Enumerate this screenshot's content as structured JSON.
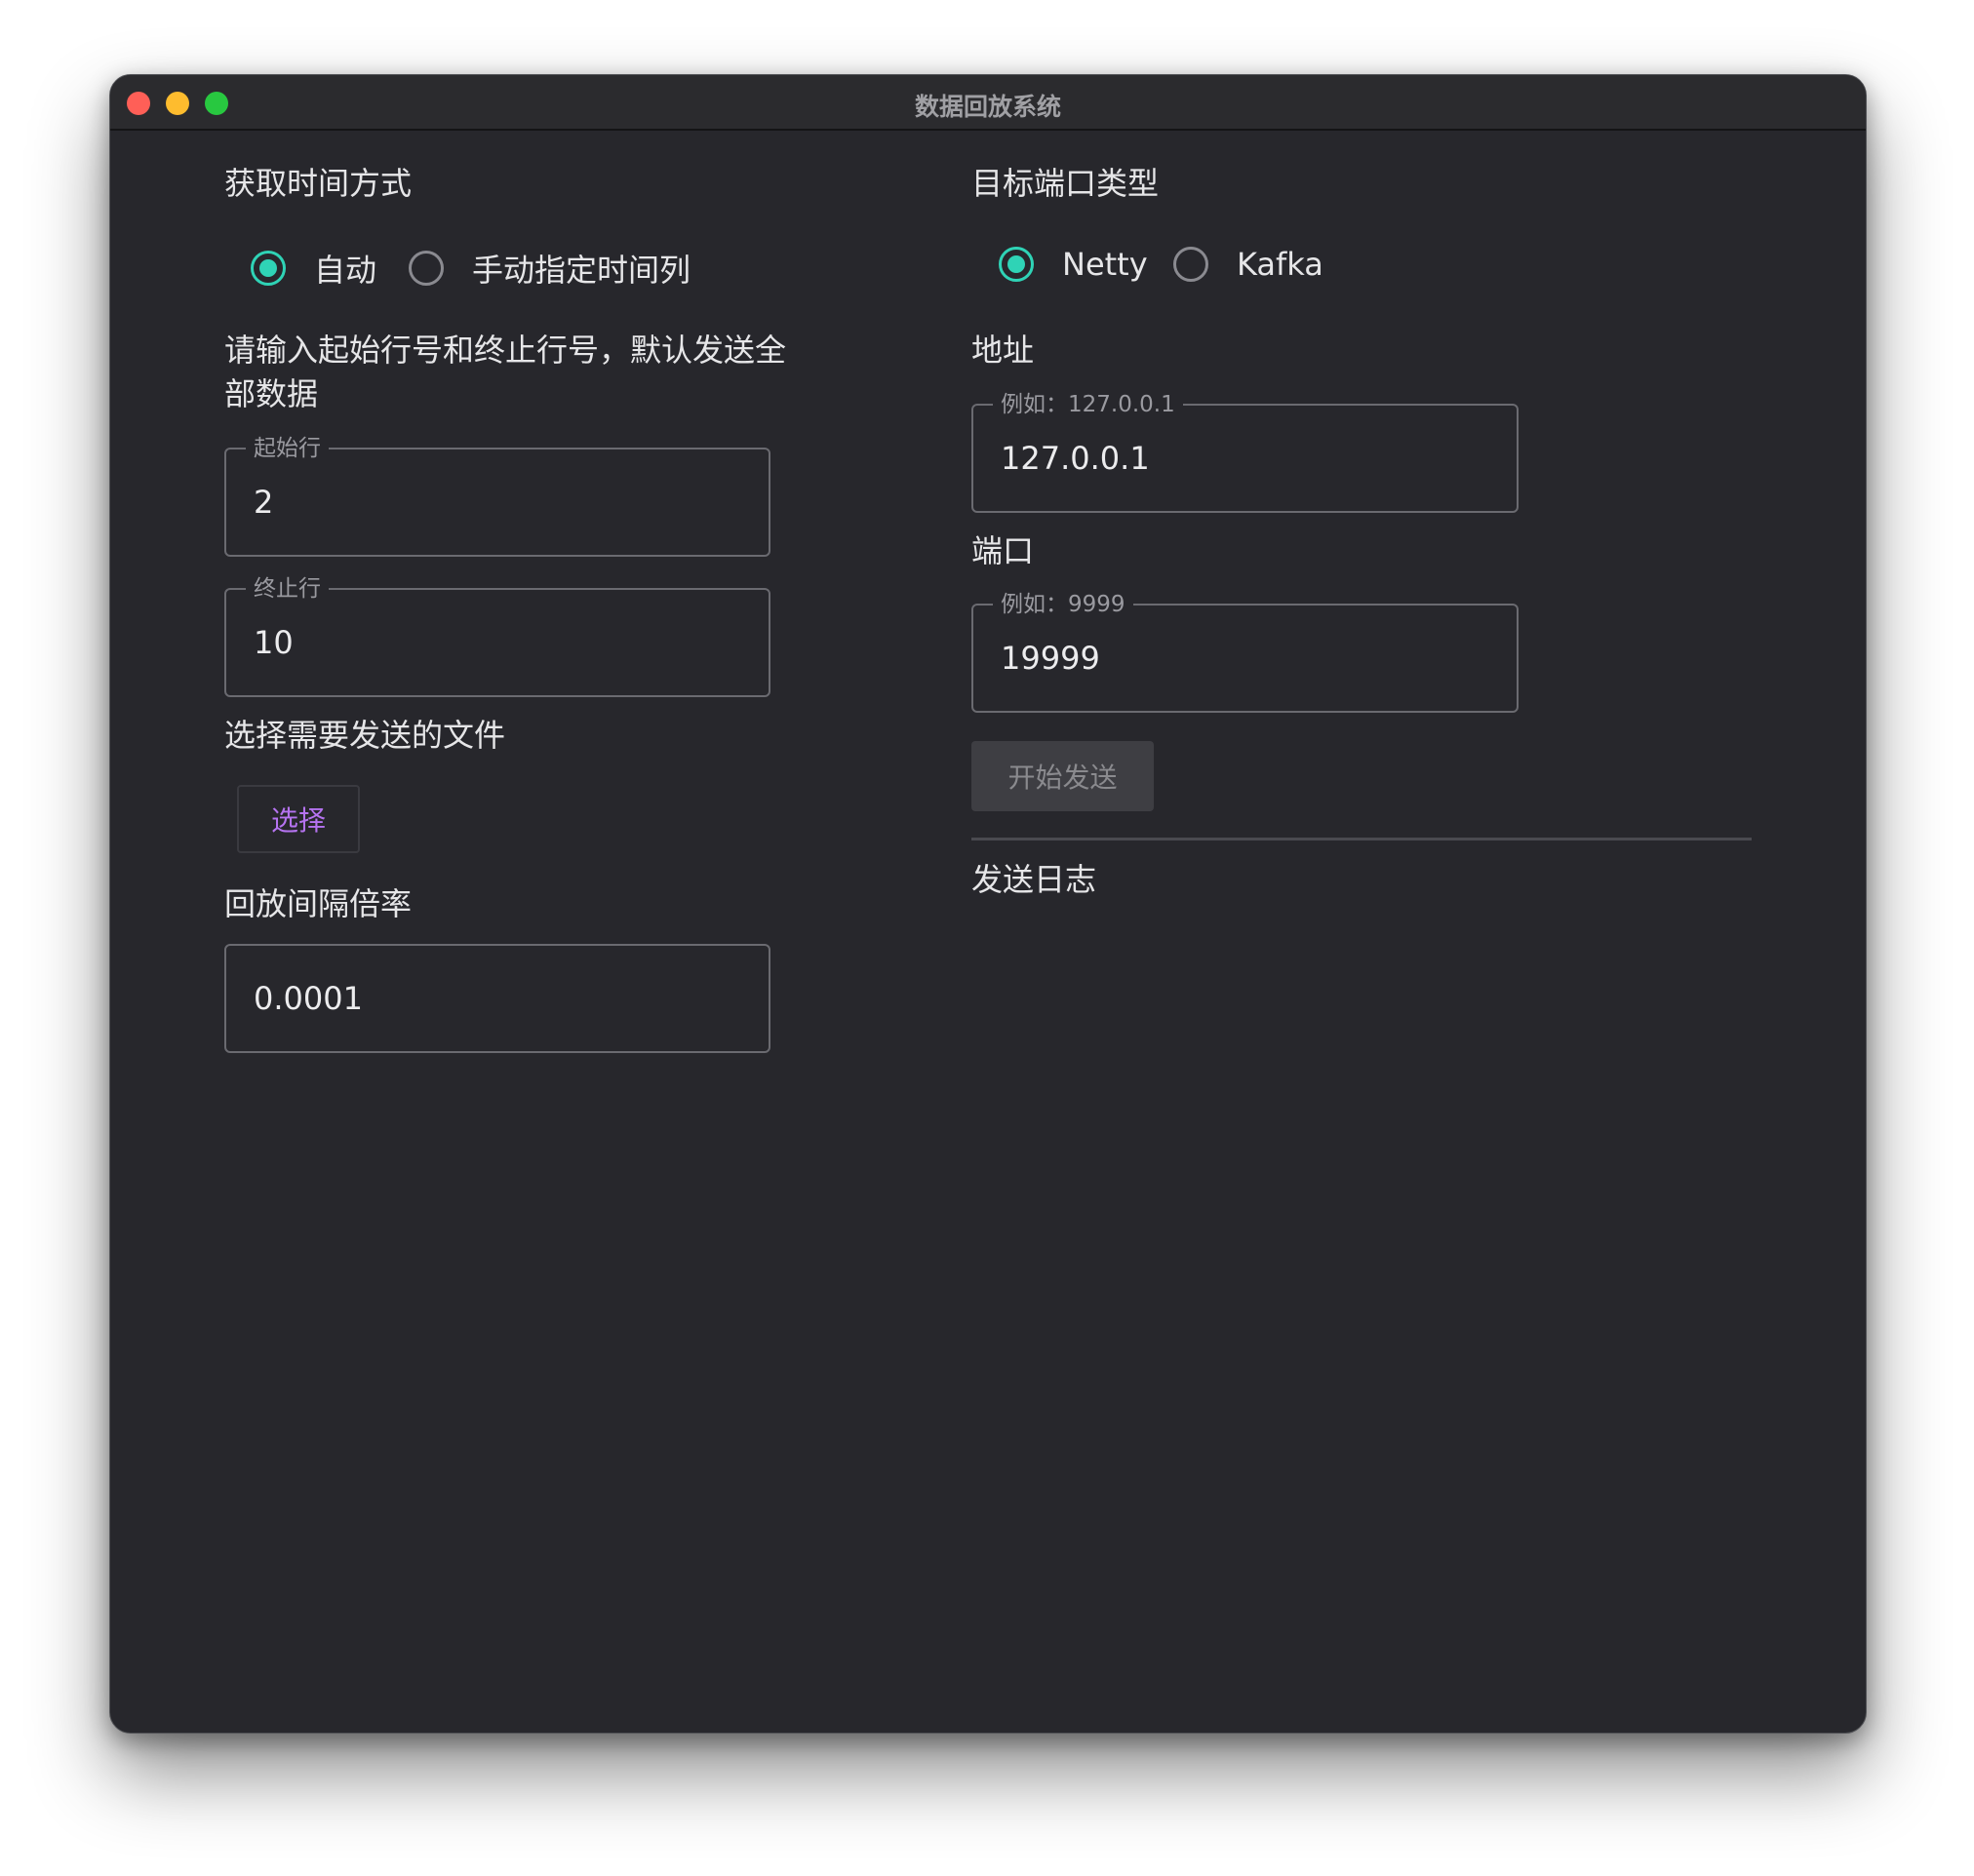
{
  "window": {
    "title": "数据回放系统"
  },
  "left": {
    "time_mode": {
      "heading": "获取时间方式",
      "options": [
        {
          "label": "自动",
          "checked": true
        },
        {
          "label": "手动指定时间列",
          "checked": false
        }
      ]
    },
    "range": {
      "heading_line1": "请输入起始行号和终止行号，默认发送全",
      "heading_line2": "部数据",
      "start": {
        "legend": "起始行",
        "value": "2"
      },
      "end": {
        "legend": "终止行",
        "value": "10"
      }
    },
    "file": {
      "heading": "选择需要发送的文件",
      "button_label": "选择"
    },
    "rate": {
      "heading": "回放间隔倍率",
      "value": "0.0001"
    }
  },
  "right": {
    "port_type": {
      "heading": "目标端口类型",
      "options": [
        {
          "label": "Netty",
          "checked": true
        },
        {
          "label": "Kafka",
          "checked": false
        }
      ]
    },
    "address": {
      "heading": "地址",
      "legend": "例如：127.0.0.1",
      "value": "127.0.0.1"
    },
    "port": {
      "heading": "端口",
      "legend": "例如：9999",
      "value": "19999"
    },
    "send_button_label": "开始发送",
    "log_heading": "发送日志"
  },
  "colors": {
    "accent": "#2fd3b6",
    "link_button": "#b573f0",
    "background": "#27272c"
  }
}
